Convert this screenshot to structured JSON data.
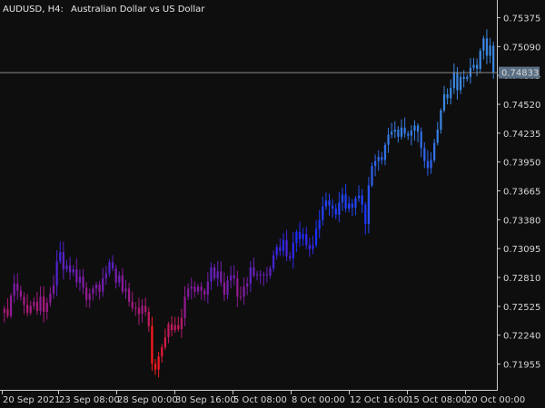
{
  "header": {
    "symbol_timeframe": "AUDUSD, H4:",
    "description": "Australian Dollar vs US Dollar"
  },
  "colors": {
    "background": "#0e0e0e",
    "axis": "#c8c8c8",
    "text": "#d6d6d6",
    "price_line": "#8a8a8a",
    "price_label_bg": "#5a6f84",
    "gradient_red": "#ff1a1a",
    "gradient_magenta": "#8a1a9a",
    "gradient_blue": "#1a2bff",
    "gradient_light_blue": "#3a86e0"
  },
  "chart_data": {
    "type": "candlestick",
    "symbol": "AUDUSD",
    "timeframe": "H4",
    "ylim": [
      0.717,
      0.7555
    ],
    "y_ticks": [
      "0.75375",
      "0.75090",
      "0.74805",
      "0.74520",
      "0.74235",
      "0.73950",
      "0.73665",
      "0.73380",
      "0.73095",
      "0.72810",
      "0.72525",
      "0.72240",
      "0.71955"
    ],
    "x_ticks": [
      "20 Sep 2021",
      "23 Sep 08:00",
      "28 Sep 00:00",
      "30 Sep 16:00",
      "5 Oct 08:00",
      "8 Oct 00:00",
      "12 Oct 16:00",
      "15 Oct 08:00",
      "20 Oct 00:00"
    ],
    "current_price": "0.74833",
    "close_path": [
      0.725,
      0.7243,
      0.7263,
      0.7275,
      0.7268,
      0.7262,
      0.7254,
      0.7246,
      0.7253,
      0.7257,
      0.7248,
      0.7262,
      0.7247,
      0.7256,
      0.7265,
      0.7273,
      0.7297,
      0.7306,
      0.7289,
      0.7293,
      0.7286,
      0.7289,
      0.7276,
      0.7282,
      0.7271,
      0.7259,
      0.7265,
      0.727,
      0.7274,
      0.7267,
      0.728,
      0.7285,
      0.7296,
      0.729,
      0.7276,
      0.7283,
      0.7267,
      0.727,
      0.7257,
      0.7251,
      0.7251,
      0.7245,
      0.7253,
      0.7247,
      0.7233,
      0.7196,
      0.719,
      0.7203,
      0.7212,
      0.7222,
      0.7235,
      0.7229,
      0.7234,
      0.723,
      0.7241,
      0.7262,
      0.727,
      0.7272,
      0.7267,
      0.7272,
      0.7268,
      0.7264,
      0.7277,
      0.7291,
      0.728,
      0.7287,
      0.7276,
      0.7264,
      0.7278,
      0.7283,
      0.728,
      0.7262,
      0.7262,
      0.7272,
      0.7275,
      0.7291,
      0.7283,
      0.7284,
      0.7283,
      0.7284,
      0.7283,
      0.729,
      0.7303,
      0.7311,
      0.7307,
      0.7318,
      0.7302,
      0.73,
      0.7315,
      0.7326,
      0.7319,
      0.7324,
      0.7313,
      0.7309,
      0.7313,
      0.7329,
      0.7338,
      0.7351,
      0.7357,
      0.7352,
      0.7349,
      0.7343,
      0.7355,
      0.7363,
      0.7349,
      0.7354,
      0.735,
      0.7359,
      0.7362,
      0.7353,
      0.7334,
      0.7372,
      0.7391,
      0.7396,
      0.74,
      0.7397,
      0.7412,
      0.7422,
      0.7425,
      0.7427,
      0.742,
      0.7429,
      0.7423,
      0.7421,
      0.7426,
      0.7431,
      0.7425,
      0.7409,
      0.7396,
      0.7389,
      0.7397,
      0.7414,
      0.7427,
      0.7446,
      0.7462,
      0.7458,
      0.7468,
      0.7483,
      0.7466,
      0.7479,
      0.7477,
      0.7479,
      0.7488,
      0.7491,
      0.7487,
      0.7505,
      0.7517,
      0.75,
      0.751,
      0.7483
    ]
  }
}
